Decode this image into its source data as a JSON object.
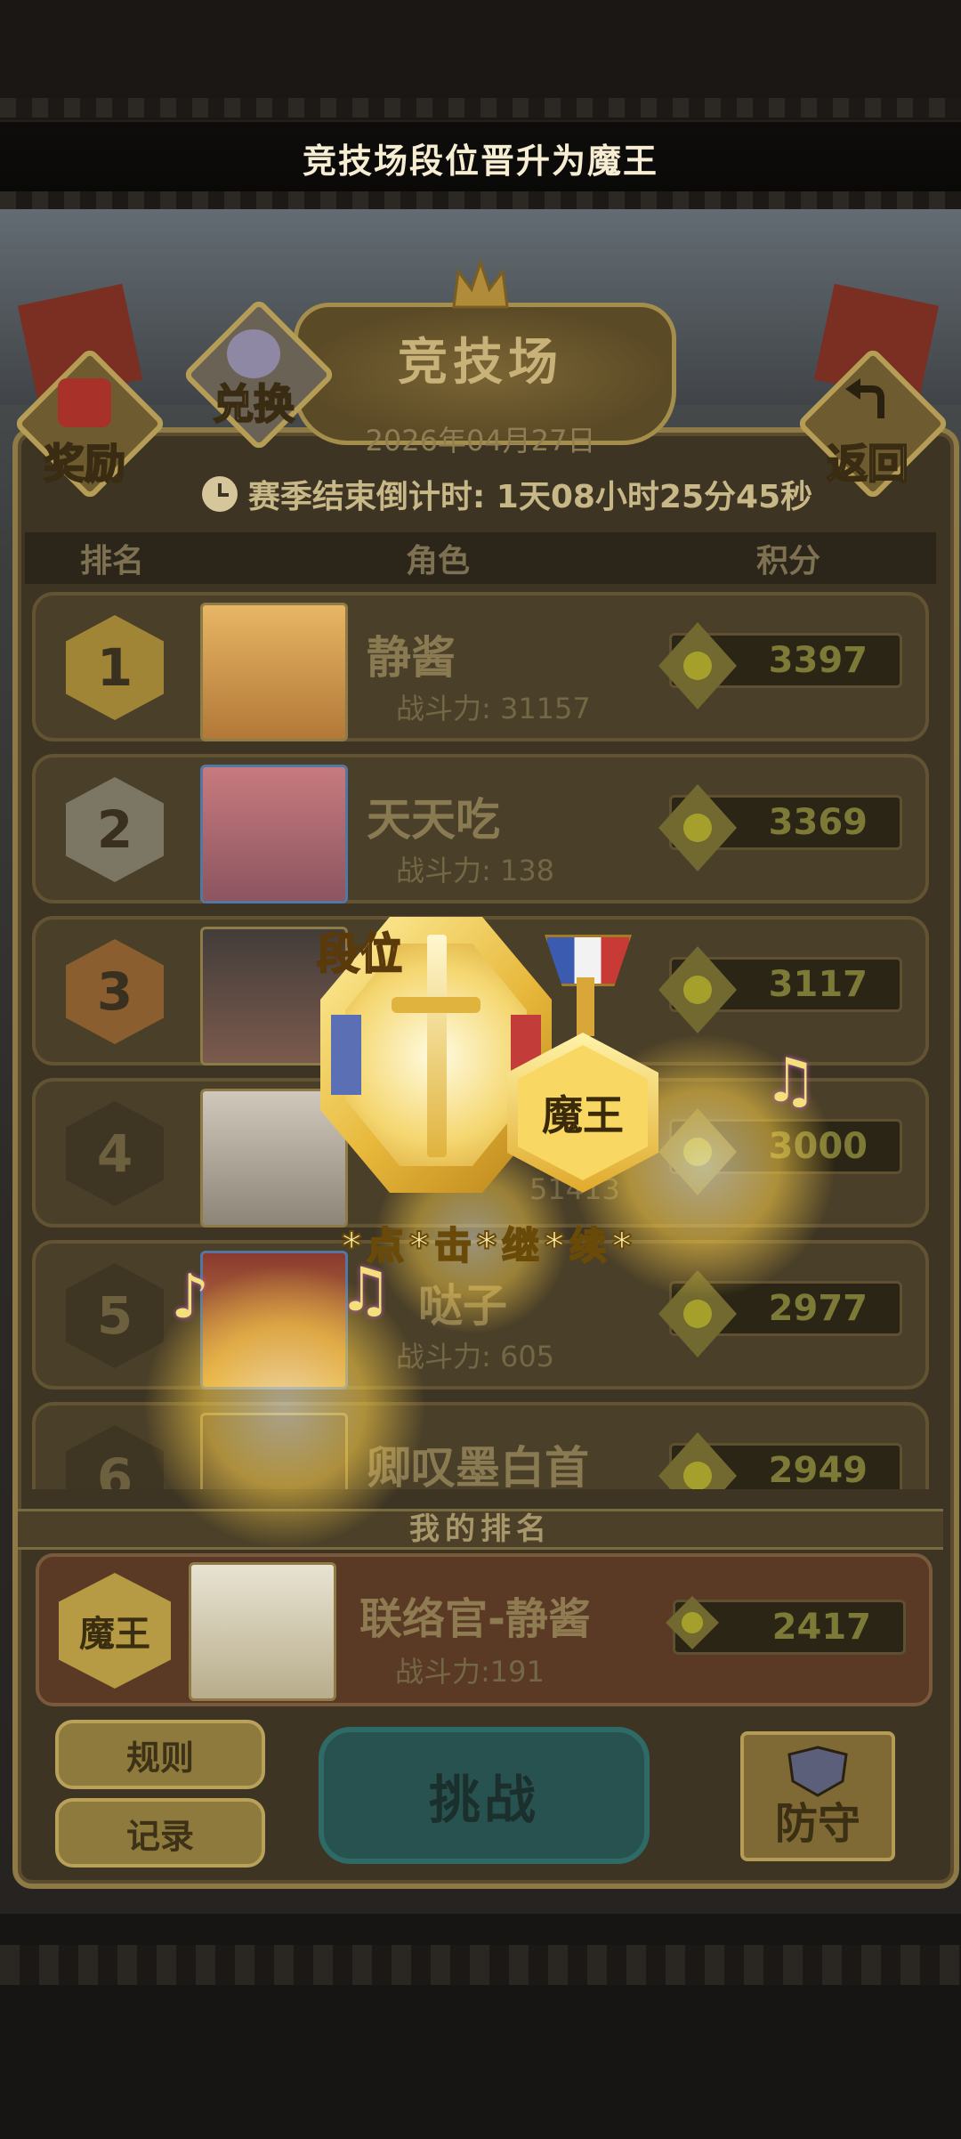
{
  "banner": {
    "title": "竞技场段位晋升为魔王"
  },
  "header": {
    "title": "竞技场",
    "date": "2026年04月27日",
    "countdown": "赛季结束倒计时: 1天08小时25分45秒"
  },
  "corner_buttons": {
    "reward": "奖励",
    "exchange": "兑换",
    "back": "返回"
  },
  "table": {
    "columns": [
      "排名",
      "角色",
      "积分"
    ],
    "rows": [
      {
        "rank": "1",
        "name": "静酱",
        "power": "战斗力: 31157",
        "score": "3397"
      },
      {
        "rank": "2",
        "name": "天天吃",
        "power": "战斗力: 138",
        "score": "3369"
      },
      {
        "rank": "3",
        "name": "",
        "power": "",
        "score": "3117"
      },
      {
        "rank": "4",
        "name": "",
        "power": "51413",
        "score": "3000"
      },
      {
        "rank": "5",
        "name": "哒子",
        "power": "战斗力: 605",
        "score": "2977"
      },
      {
        "rank": "6",
        "name": "卿叹墨白首",
        "power": "",
        "score": "2949"
      }
    ]
  },
  "my_rank": {
    "label": "我的排名",
    "tier": "魔王",
    "name": "联络官-静酱",
    "power": "战斗力:191",
    "score": "2417"
  },
  "buttons": {
    "rules": "规则",
    "records": "记录",
    "challenge": "挑战",
    "defend": "防守"
  },
  "overlay": {
    "tier_label": "段位",
    "tier_name": "魔王",
    "continue": "*点*击*继*续*"
  },
  "colors": {
    "board": "#3d3423",
    "gold": "#b69d56",
    "challenge_teal": "#27524f"
  }
}
